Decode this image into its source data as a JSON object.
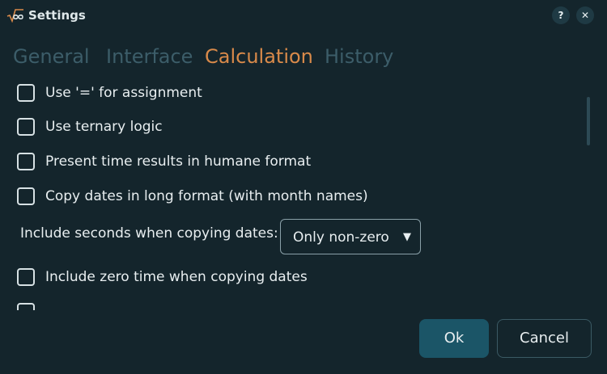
{
  "window": {
    "title": "Settings",
    "app_icon": "sqrt-infinity-icon",
    "help_label": "?",
    "close_label": "✕"
  },
  "tabs": [
    {
      "label": "General",
      "active": false
    },
    {
      "label": "Interface",
      "active": false
    },
    {
      "label": "Calculation",
      "active": true
    },
    {
      "label": "History",
      "active": false
    }
  ],
  "options": {
    "use_equals_assignment": {
      "label": "Use '=' for assignment",
      "checked": false
    },
    "ternary_logic": {
      "label": "Use ternary logic",
      "checked": false
    },
    "humane_time": {
      "label": "Present time results in humane format",
      "checked": false
    },
    "long_dates": {
      "label": "Copy dates in long format (with month names)",
      "checked": false
    },
    "zero_time": {
      "label": "Include zero time when copying dates",
      "checked": false
    }
  },
  "seconds_select": {
    "label": "Include seconds when copying dates:",
    "value": "Only non-zero",
    "arrow": "▼"
  },
  "buttons": {
    "ok": "Ok",
    "cancel": "Cancel"
  },
  "colors": {
    "background": "#14252c",
    "active_tab": "#d98a4a",
    "inactive_tab": "#3c5d69",
    "primary_button": "#1b5567"
  }
}
